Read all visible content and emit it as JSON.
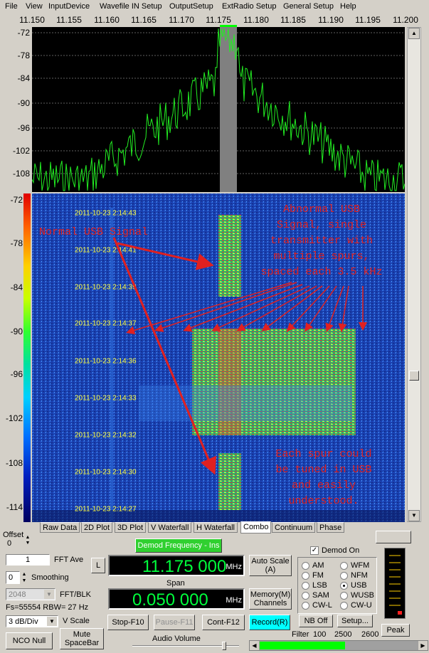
{
  "menu": [
    "File",
    "View",
    "InputDevice",
    "Wavefile IN Setup",
    "OutputSetup",
    "ExtRadio Setup",
    "General Setup",
    "Help"
  ],
  "freq_ticks": [
    "11.150",
    "11.155",
    "11.160",
    "11.165",
    "11.170",
    "11.175",
    "11.180",
    "11.185",
    "11.190",
    "11.195",
    "11.200"
  ],
  "spectrum_db": [
    "-72",
    "-78",
    "-84",
    "-90",
    "-96",
    "-102",
    "-108"
  ],
  "waterfall_db": [
    "-72",
    "-78",
    "-84",
    "-90",
    "-96",
    "-102",
    "-108",
    "-114"
  ],
  "timestamps": [
    "2011-10-23 2:14:43",
    "2011-10-23 2:14:41",
    "2011-10-23 2:14:39",
    "2011-10-23 2:14:37",
    "2011-10-23 2:14:36",
    "2011-10-23 2:14:33",
    "2011-10-23 2:14:32",
    "2011-10-23 2:14:30",
    "2011-10-23 2:14:27"
  ],
  "annotations": {
    "normal": "Normal USB Signal",
    "abnormal": [
      "Abnormal USB",
      "Signal, single",
      "transmitter with",
      "multiple spurs,",
      "spaced each 3.5 kHz"
    ],
    "spur": [
      "Each spur could",
      "be tuned in USB",
      "and easily",
      "understood."
    ]
  },
  "tabs": [
    "Raw Data",
    "2D Plot",
    "3D Plot",
    "V Waterfall",
    "H Waterfall",
    "Combo",
    "Continuum",
    "Phase"
  ],
  "active_tab": "Combo",
  "offset": {
    "label": "Offset",
    "value": "0"
  },
  "fft_ave": {
    "value": "1",
    "label": "FFT Ave"
  },
  "smoothing": {
    "value": "0",
    "label": "Smoothing"
  },
  "fft_blk": {
    "value": "2048",
    "label": "FFT/BLK"
  },
  "fs_line": "Fs=55554 RBW= 27 Hz",
  "vscale": {
    "value": "3 dB/Div",
    "label": "V Scale"
  },
  "demod_freq_btn": "Demod Frequency - Ins",
  "l_btn": "L",
  "freq_display": {
    "value": "11.175 000",
    "unit": "MHz"
  },
  "span_label": "Span",
  "span_display": {
    "value": "0.050 000",
    "unit": "MHz"
  },
  "auto_scale": [
    "Auto Scale",
    "(A)"
  ],
  "memory": [
    "Memory(M)",
    "Channels"
  ],
  "stop_btn": "Stop-F10",
  "pause_btn": "Pause-F11",
  "cont_btn": "Cont-F12",
  "record_btn": "Record(R)",
  "nco_btn": "NCO Null",
  "mute_btn": [
    "Mute",
    "SpaceBar"
  ],
  "audio_volume": "Audio Volume",
  "demod_on": "Demod On",
  "modes": [
    {
      "label": "AM",
      "on": false
    },
    {
      "label": "WFM",
      "on": false
    },
    {
      "label": "FM",
      "on": false
    },
    {
      "label": "NFM",
      "on": false
    },
    {
      "label": "LSB",
      "on": false
    },
    {
      "label": "USB",
      "on": true
    },
    {
      "label": "SAM",
      "on": false
    },
    {
      "label": "WUSB",
      "on": false
    },
    {
      "label": "CW-L",
      "on": false
    },
    {
      "label": "CW-U",
      "on": false
    }
  ],
  "nb_off": "NB Off",
  "setup_btn": "Setup...",
  "peak_btn": "Peak",
  "filter_label": "Filter",
  "filter_values": [
    "100",
    "2500",
    "2600"
  ],
  "colors": {
    "spectrum": "#22ee22",
    "annotation": "#e02020",
    "lcd": "#00ff3c",
    "record": "#00ffff",
    "demod": "#30d030"
  }
}
